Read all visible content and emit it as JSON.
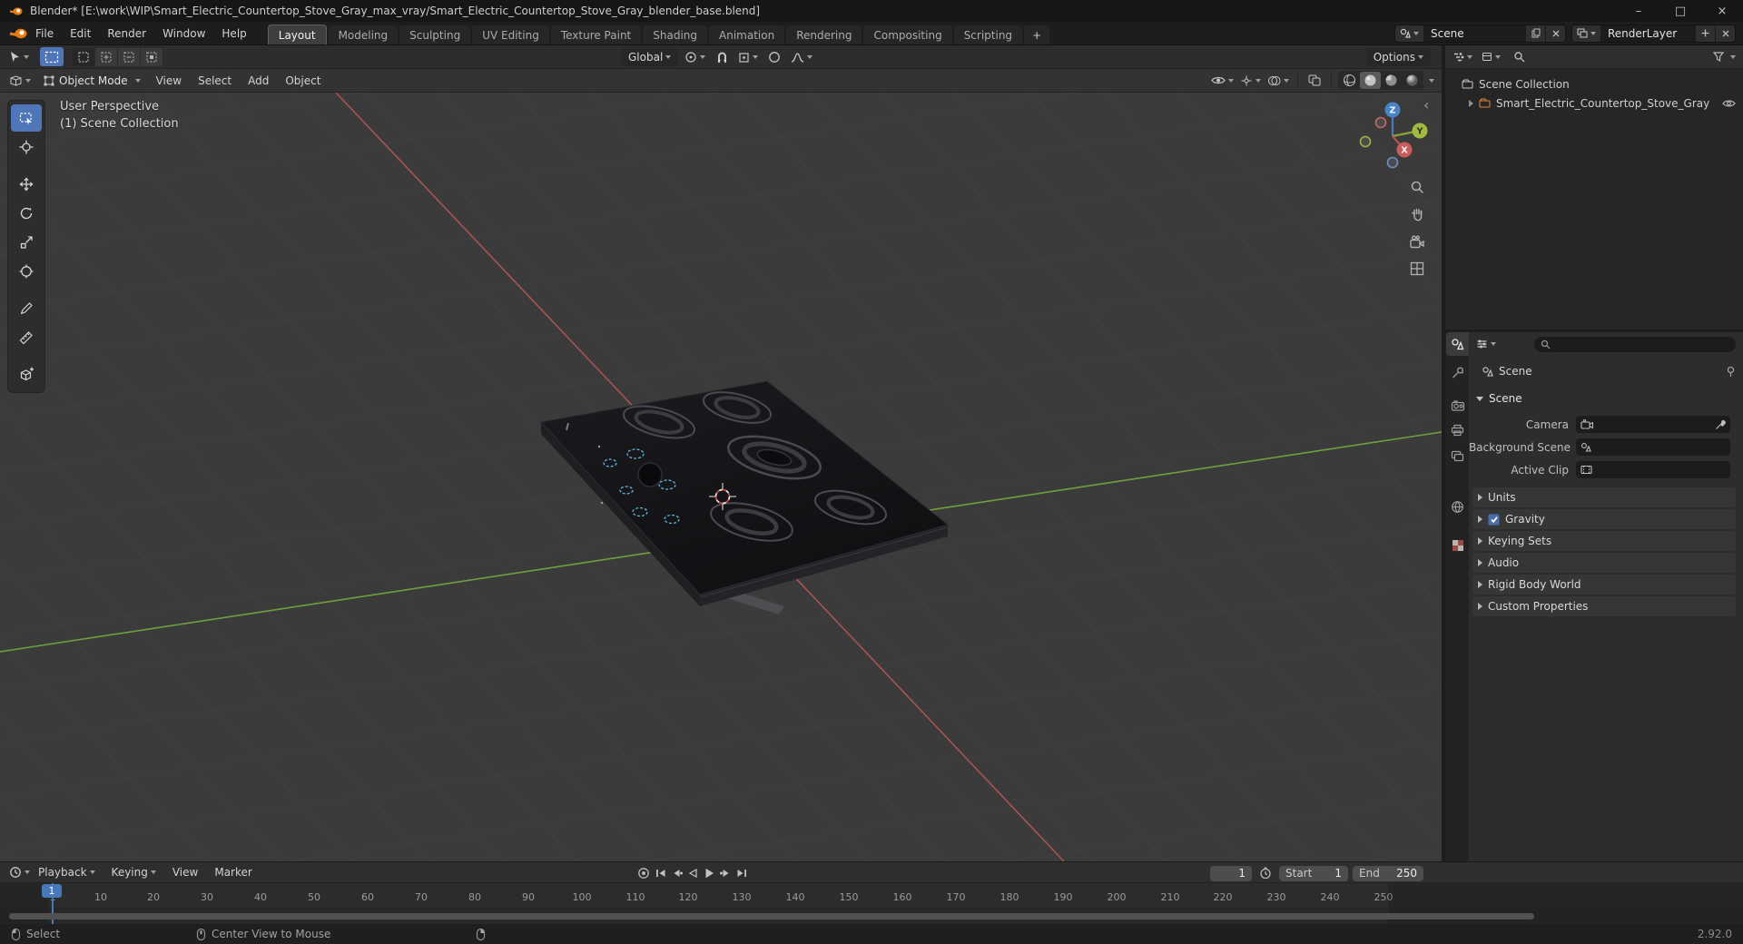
{
  "titlebar": {
    "title": "Blender* [E:\\work\\WIP\\Smart_Electric_Countertop_Stove_Gray_max_vray/Smart_Electric_Countertop_Stove_Gray_blender_base.blend]",
    "controls": {
      "minimize": "–",
      "maximize": "□",
      "close": "×"
    }
  },
  "topbar": {
    "menus": [
      "File",
      "Edit",
      "Render",
      "Window",
      "Help"
    ],
    "tabs": [
      "Layout",
      "Modeling",
      "Sculpting",
      "UV Editing",
      "Texture Paint",
      "Shading",
      "Animation",
      "Rendering",
      "Compositing",
      "Scripting"
    ],
    "add_tab": "+",
    "scene": {
      "value": "Scene"
    },
    "view_layer": {
      "value": "RenderLayer"
    }
  },
  "tool_settings": {
    "orientation": "Global",
    "options_label": "Options"
  },
  "viewport_header": {
    "mode": "Object Mode",
    "menus": [
      "View",
      "Select",
      "Add",
      "Object"
    ]
  },
  "viewport": {
    "overlay": [
      "User Perspective",
      "(1) Scene Collection"
    ],
    "gizmo_axes": {
      "x": "X",
      "y": "Y",
      "z": "Z"
    },
    "collapse_arrow": "‹"
  },
  "outliner": {
    "rows": [
      {
        "label": "Scene Collection"
      },
      {
        "label": "Smart_Electric_Countertop_Stove_Gray"
      }
    ]
  },
  "properties": {
    "breadcrumb": "Scene",
    "scene_section": "Scene",
    "rows": [
      {
        "label": "Camera",
        "value": ""
      },
      {
        "label": "Background Scene",
        "value": ""
      },
      {
        "label": "Active Clip",
        "value": ""
      }
    ],
    "panels": [
      "Units",
      "Gravity",
      "Keying Sets",
      "Audio",
      "Rigid Body World",
      "Custom Properties"
    ]
  },
  "timeline": {
    "menus": [
      "Playback",
      "Keying",
      "View",
      "Marker"
    ],
    "frame_field": "1",
    "start_label": "Start",
    "start_value": "1",
    "end_label": "End",
    "end_value": "250",
    "playhead": "1",
    "ruler": [
      "1",
      "10",
      "20",
      "30",
      "40",
      "50",
      "60",
      "70",
      "80",
      "90",
      "100",
      "110",
      "120",
      "130",
      "140",
      "150",
      "160",
      "170",
      "180",
      "190",
      "200",
      "210",
      "220",
      "230",
      "240",
      "250"
    ]
  },
  "statusbar": {
    "select_label": "Select",
    "center_label": "Center View to Mouse",
    "version": "2.92.0"
  },
  "colors": {
    "accent": "#4772b3",
    "axis_x": "#a85454",
    "axis_y": "#6fa03f"
  }
}
